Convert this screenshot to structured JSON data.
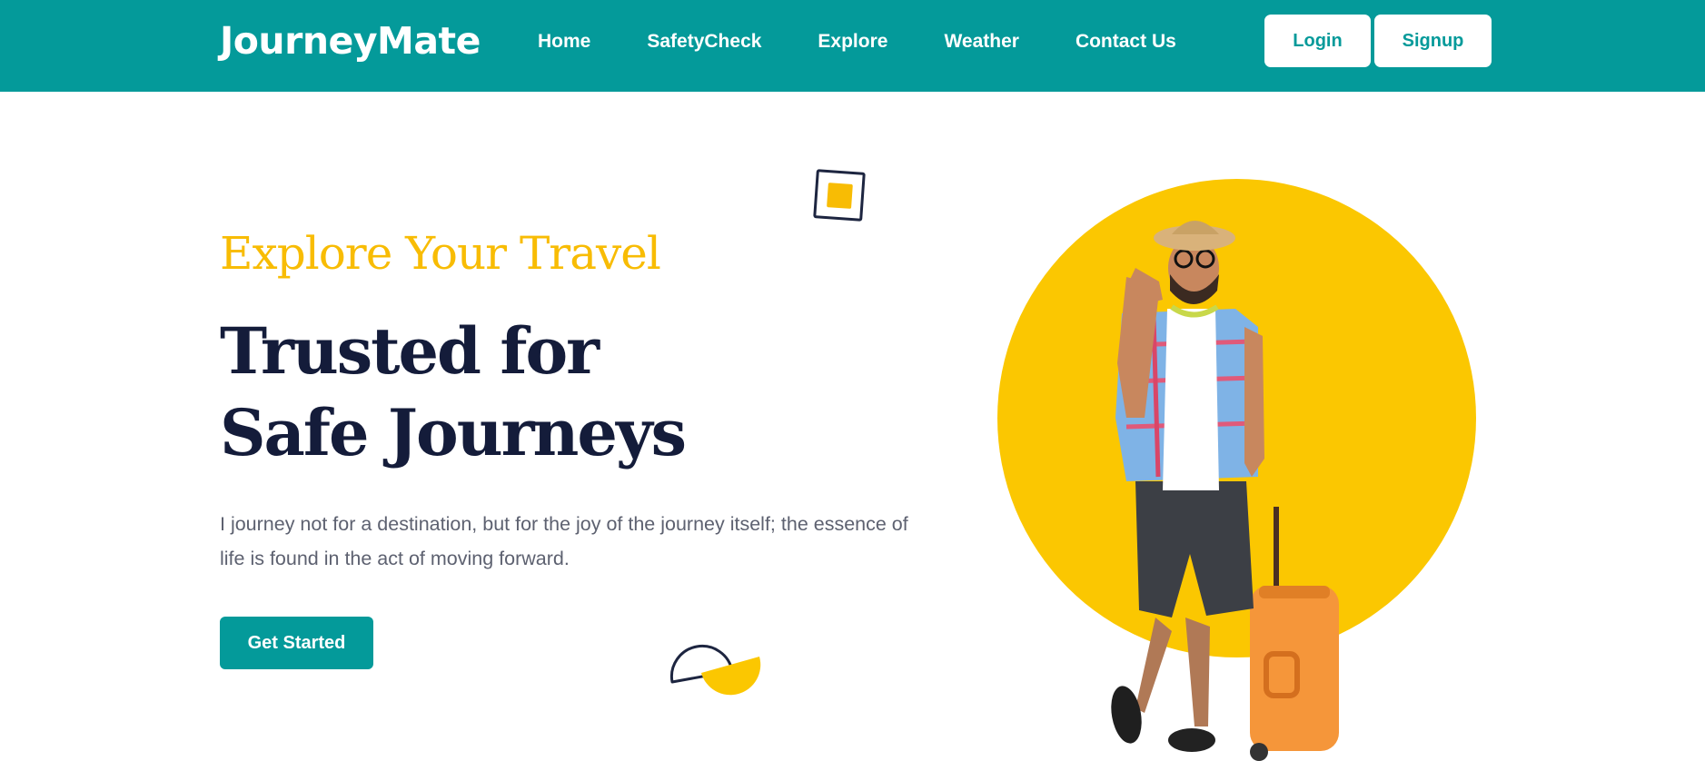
{
  "brand": {
    "name": "JourneyMate"
  },
  "nav": {
    "links": [
      "Home",
      "SafetyCheck",
      "Explore",
      "Weather",
      "Contact Us"
    ],
    "login_label": "Login",
    "signup_label": "Signup"
  },
  "hero": {
    "kicker": "Explore Your Travel",
    "title_line1": "Trusted for",
    "title_line2": "Safe Journeys",
    "description": "I journey not for a destination, but for the joy of the journey itself; the essence of life is found in the act of moving forward.",
    "cta_label": "Get Started"
  },
  "colors": {
    "primary_teal": "#049a9a",
    "accent_yellow": "#fbc701",
    "heading_navy": "#141c3a",
    "body_gray": "#5d6170"
  },
  "icons": {
    "square_deco": "square-outline-with-yellow-square",
    "half_circle_deco": "half-circles-navy-yellow",
    "hero_image": "traveler-with-suitcase"
  }
}
